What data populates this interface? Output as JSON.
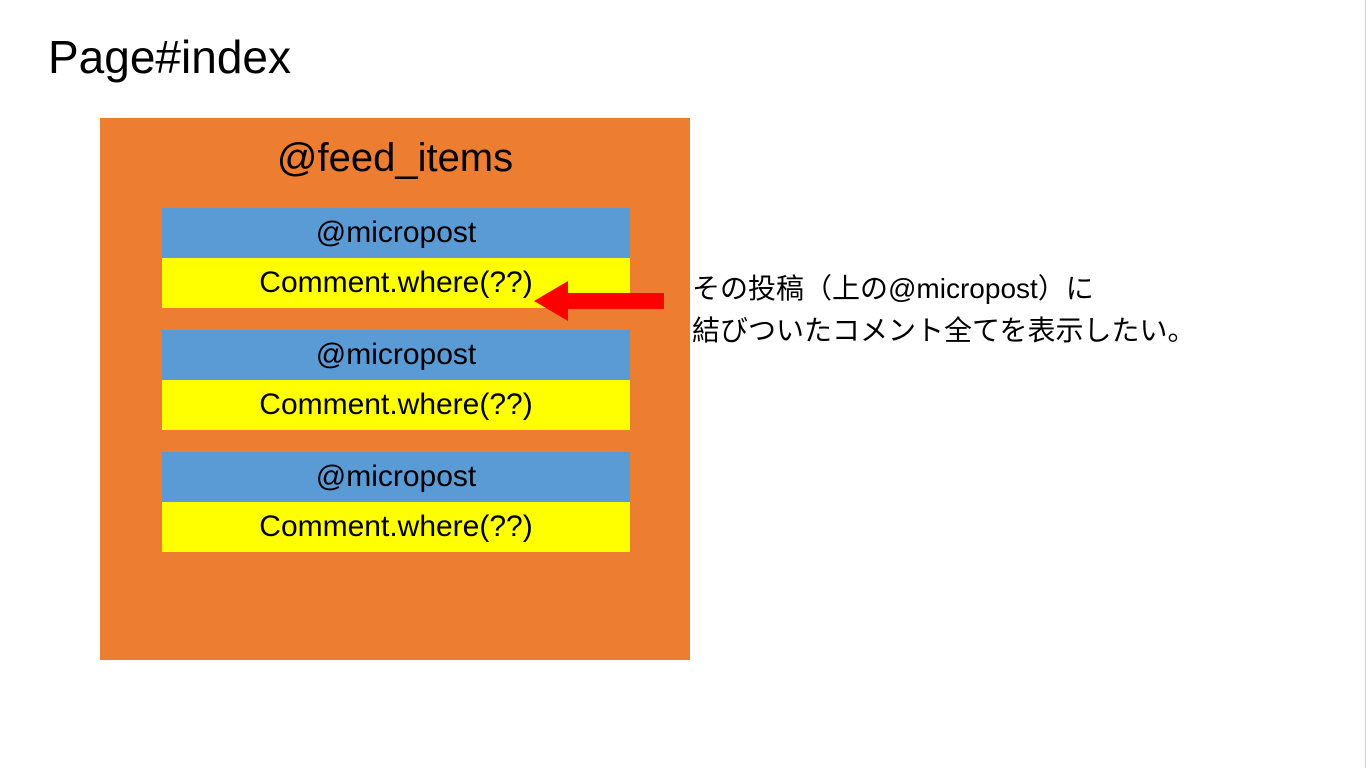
{
  "page_title": "Page#index",
  "feed_title": "@feed_items",
  "rows": {
    "micropost_label": "@micropost",
    "comment_label": "Comment.where(??)"
  },
  "annotation": {
    "line1": "その投稿（上の@micropost）に",
    "line2": "結びついたコメント全てを表示したい。"
  },
  "colors": {
    "container": "#ed7d31",
    "micropost": "#5b9bd5",
    "comment": "#ffff00",
    "arrow": "#ff0000"
  }
}
